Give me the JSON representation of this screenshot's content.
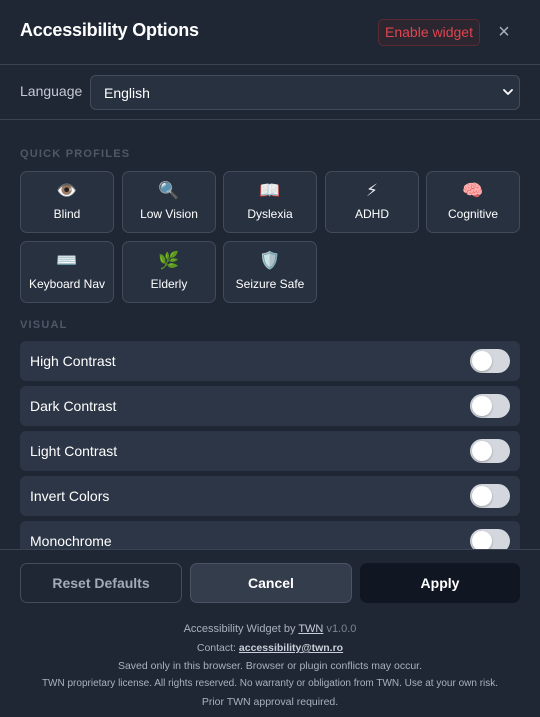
{
  "header": {
    "title": "Accessibility Options",
    "enable_label": "Enable widget",
    "close_glyph": "×"
  },
  "language": {
    "label": "Language",
    "selected": "English"
  },
  "quick_profiles": {
    "title": "QUICK PROFILES",
    "items": [
      {
        "label": "Blind",
        "icon": "👁️",
        "icon_name": "eye-icon"
      },
      {
        "label": "Low Vision",
        "icon": "🔍",
        "icon_name": "magnifier-icon"
      },
      {
        "label": "Dyslexia",
        "icon": "📖",
        "icon_name": "book-icon"
      },
      {
        "label": "ADHD",
        "icon": "⚡",
        "icon_name": "lightning-icon"
      },
      {
        "label": "Cognitive",
        "icon": "🧠",
        "icon_name": "brain-icon"
      },
      {
        "label": "Keyboard Nav",
        "icon": "⌨️",
        "icon_name": "keyboard-icon"
      },
      {
        "label": "Elderly",
        "icon": "🌿",
        "icon_name": "herb-icon"
      },
      {
        "label": "Seizure Safe",
        "icon": "🛡️",
        "icon_name": "shield-icon"
      }
    ]
  },
  "visual": {
    "title": "VISUAL",
    "toggles": [
      {
        "label": "High Contrast",
        "on": false
      },
      {
        "label": "Dark Contrast",
        "on": false
      },
      {
        "label": "Light Contrast",
        "on": false
      },
      {
        "label": "Invert Colors",
        "on": false
      },
      {
        "label": "Monochrome",
        "on": false
      }
    ]
  },
  "footer": {
    "reset_label": "Reset Defaults",
    "cancel_label": "Cancel",
    "apply_label": "Apply",
    "credit_prefix": "Accessibility Widget by",
    "credit_link": "TWN",
    "version": "v1.0.0",
    "contact_prefix": "Contact:",
    "contact_email": "accessibility@twn.ro",
    "note": "Saved only in this browser. Browser or plugin conflicts may occur.",
    "license": "TWN proprietary license. All rights reserved. No warranty or obligation from TWN. Use at your own risk.",
    "approval": "Prior TWN approval required."
  },
  "colors": {
    "background": "#1f2734",
    "panel": "#283140",
    "row": "#2d3646",
    "danger": "#e0454f",
    "apply": "#111722"
  }
}
